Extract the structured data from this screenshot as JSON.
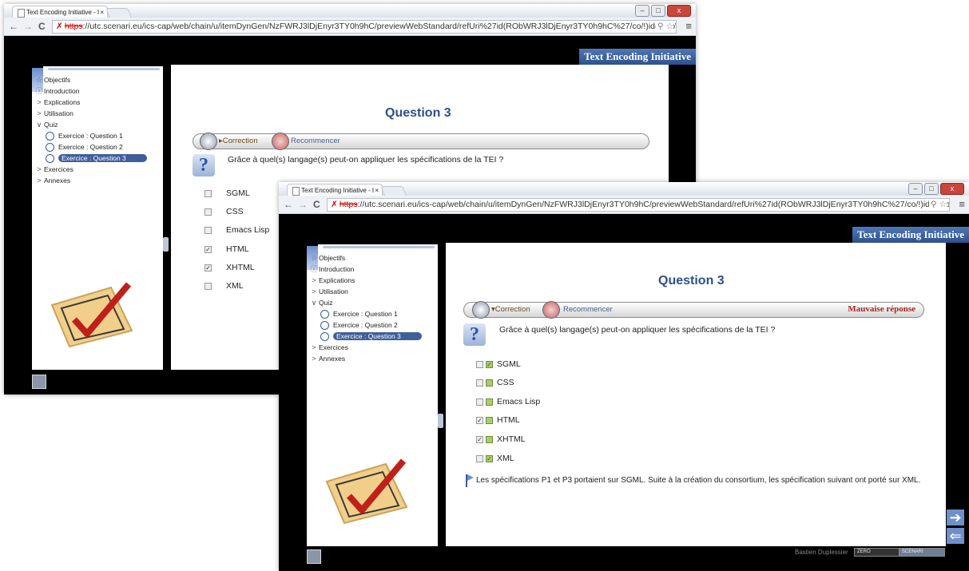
{
  "browser": {
    "tab_title": "Text Encoding Initiative - I",
    "tab_close": "×",
    "nav_back": "←",
    "nav_forward": "→",
    "reload": "C",
    "url_scheme": "https",
    "url_rest": "://utc.scenari.eu/ics-cap/web/chain/u/itemDynGen/NzFWRJ3lDjEnyr3TY0h9hC/previewWebStandard/refUri%27id(RObWRJ3lDjEnyr3TY0h9hC%27/co/!)id(RObWR",
    "url_rest2": "://utc.scenari.eu/ics-cap/web/chain/u/itemDynGen/NzFWRJ3lDjEnyr3TY0h9hC/previewWebStandard/refUri%27id(RObWRJ3lDjEnyr3TY0h9hC%27/co/!)id(RObWR",
    "menu_icon": "≡",
    "star_icon": "☆",
    "window_min": "–",
    "window_max": "□",
    "window_close": "x"
  },
  "app": {
    "header_title": "Text Encoding Initiative",
    "page_title": "Question 3"
  },
  "outline": [
    {
      "label": "Objectifs",
      "icon": "star-icon"
    },
    {
      "label": "Introduction",
      "icon": "info-icon"
    },
    {
      "label": "Explications",
      "icon": "chevron-right-icon"
    },
    {
      "label": "Utilisation",
      "icon": "chevron-right-icon"
    },
    {
      "label": "Quiz",
      "icon": "chevron-down-icon"
    },
    {
      "label": "Exercice : Question 1",
      "icon": "circle-icon"
    },
    {
      "label": "Exercice : Question 2",
      "icon": "circle-icon"
    },
    {
      "label": "Exercice : Question 3",
      "icon": "circle-icon"
    },
    {
      "label": "Exercices",
      "icon": "chevron-right-icon"
    },
    {
      "label": "Annexes",
      "icon": "chevron-right-icon"
    }
  ],
  "toolbar": {
    "correction": "Correction",
    "restart": "Recommencer",
    "verdict": "Mauvaise réponse"
  },
  "question": {
    "text": "Grâce à quel(s) langage(s) peut-on appliquer les spécifications de la TEI ?",
    "options": [
      {
        "label": "SGML",
        "checked": false,
        "correct": true
      },
      {
        "label": "CSS",
        "checked": false,
        "correct": false
      },
      {
        "label": "Emacs Lisp",
        "checked": false,
        "correct": false
      },
      {
        "label": "HTML",
        "checked": true,
        "correct": false
      },
      {
        "label": "XHTML",
        "checked": true,
        "correct": false
      },
      {
        "label": "XML",
        "checked": false,
        "correct": true
      }
    ]
  },
  "feedback": "Les spécifications P1 et P3 portaient sur SGML. Suite à la création du consortium, les spécification suivant ont porté sur XML.",
  "footer": {
    "author": "Bastien Duplessier",
    "badge1": "ZERO",
    "badge2": "SCENARI"
  },
  "colors": {
    "accent": "#2d4f8c",
    "selected": "#3f5f9a",
    "error": "#a52a1e"
  }
}
